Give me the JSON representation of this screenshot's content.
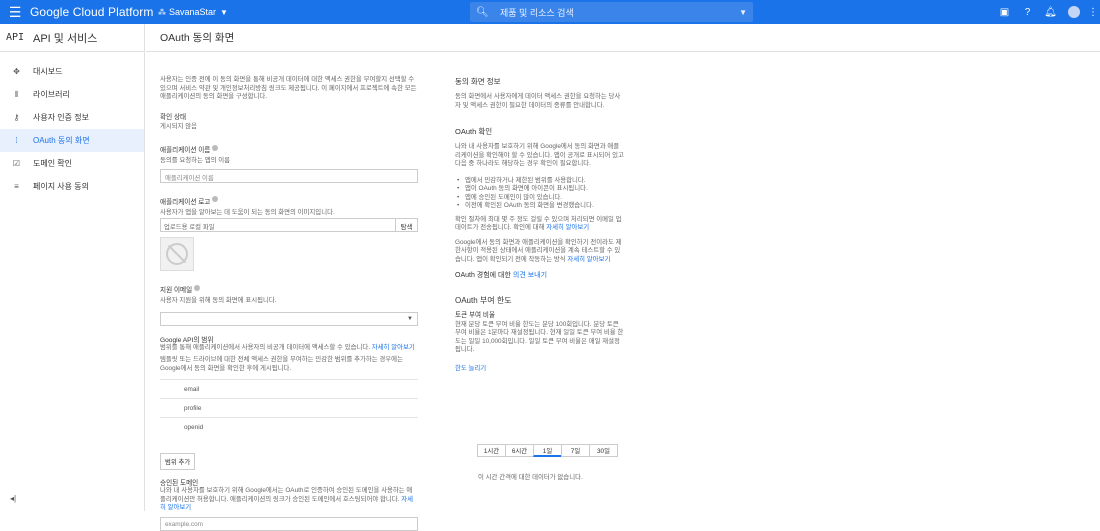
{
  "topbar": {
    "brand": "Google Cloud Platform",
    "project": "SavanaStar",
    "search_placeholder": "제품 및 리소스 검색",
    "icons": [
      "menu-icon",
      "console-icon",
      "help-icon",
      "notifications-icon",
      "avatar",
      "more-vert-icon"
    ],
    "accent": "#1a73e8"
  },
  "sidebar": {
    "logo": "API",
    "title": "API 및 서비스",
    "items": [
      {
        "label": "대시보드",
        "icon": "dashboard-icon"
      },
      {
        "label": "라이브러리",
        "icon": "library-icon"
      },
      {
        "label": "사용자 인증 정보",
        "icon": "key-icon"
      },
      {
        "label": "OAuth 동의 화면",
        "icon": "consent-icon",
        "active": true
      },
      {
        "label": "도메인 확인",
        "icon": "domain-icon"
      },
      {
        "label": "페이지 사용 동의",
        "icon": "settings-list-icon"
      }
    ],
    "collapse": "◂|"
  },
  "header": {
    "title": "OAuth 동의 화면"
  },
  "form": {
    "intro": "사용자는 인증 전에 이 동의 화면을 통해 비공개 데이터에 대한 액세스 권한을 부여할지 선택할 수 있으며 서비스 약관 및 개인정보처리방침 링크도 제공됩니다. 이 페이지에서 프로젝트에 속한 모든 애플리케이션의 동의 화면을 구성합니다.",
    "verify_label": "확인 상태",
    "verify_value": "게시되지 않음",
    "app_name_label": "애플리케이션 이름",
    "app_name_desc": "동의를 요청하는 앱의 이름",
    "app_name_placeholder": "애플리케이션 이름",
    "logo_label": "애플리케이션 로고",
    "logo_desc": "사용자가 앱을 알아보는 데 도움이 되는 동의 화면의 이미지입니다.",
    "upload_placeholder": "업로드용 로컬 파일",
    "browse": "탐색",
    "email_label": "지원 이메일",
    "email_desc": "사용자 지원을 위해 동의 화면에 표시됩니다.",
    "scopes_label": "Google API의 범위",
    "scopes_desc_a": "범위를 통해 애플리케이션에서 사용자의 비공개 데이터에 액세스할 수 있습니다.",
    "scopes_link": "자세히 알아보기",
    "scopes_desc_b": "템플릿 또는 드라이브에 대한 전체 액세스 권한을 부여하는 민감한 범위를 추가하는 경우에는 Google에서 동의 화면을 확인한 후에 게시됩니다.",
    "scopes": [
      "email",
      "profile",
      "openid"
    ],
    "add_scope": "범위 추가",
    "domains_label": "승인된 도메인",
    "domains_desc": "나와 내 사용자를 보호하기 위해 Google에서는 OAuth로 인증하여 승인된 도메인을 사용하는 애플리케이션만 허용합니다. 애플리케이션의 링크가 승인된 도메인에서 호스팅되어야 합니다.",
    "domains_link": "자세히 알아보기",
    "domain_placeholder": "example.com"
  },
  "right": {
    "consent_title": "동의 화면 정보",
    "consent_desc": "동의 화면에서 사용자에게 데이터 액세스 권한을 요청하는 당사자 및 액세스 권한이 필요한 데이터의 종류를 안내합니다.",
    "oauth_verify_title": "OAuth 확인",
    "oauth_verify_desc": "나와 내 사용자를 보호하기 위해 Google에서 동의 화면과 애플리케이션을 확인해야 할 수 있습니다. 앱이 공개로 표시되어 있고 다음 중 하나라도 해당하는 경우 확인이 필요합니다.",
    "bullets": [
      "앱에서 민감하거나 제한된 범위를 사용합니다.",
      "앱이 OAuth 동의 화면에 아이콘이 표시됩니다.",
      "앱에 승인된 도메인이 많이 있습니다.",
      "이전에 확인된 OAuth 동의 화면을 변경했습니다."
    ],
    "verify_time": "확인 절차에 최대 몇 주 정도 걸릴 수 있으며 처리되면 이메일 업데이트가 전송됩니다. 확인에 대해",
    "verify_link": "자세히 알아보기",
    "google_verify": "Google에서 동의 화면과 애플리케이션을 확인하기 전이라도 제한사항이 적용된 상태에서 애플리케이션을 계속 테스트할 수 있습니다. 앱이 확인되기 전에 작동하는 방식",
    "google_verify_link": "자세히 알아보기",
    "feedback_text": "OAuth 경험에 대한",
    "feedback_link": "의견 보내기",
    "grant_title": "OAuth 부여 한도",
    "grant_sub": "토큰 부여 비율",
    "grant_desc": "현재 분당 토큰 부여 비율 한도는 분당 100회입니다. 분당 토큰 부여 비율은 1분마다 재설정됩니다. 현재 일일 토큰 부여 비율 한도는 일일 10,000회입니다. 일일 토큰 부여 비율은 매일 재설정됩니다.",
    "raise_link": "한도 늘리기",
    "tabs": [
      "1시간",
      "6시간",
      "1일",
      "7일",
      "30일"
    ],
    "selected_tab": "1일",
    "no_data": "이 시간 간격에 대한 데이터가 없습니다."
  }
}
